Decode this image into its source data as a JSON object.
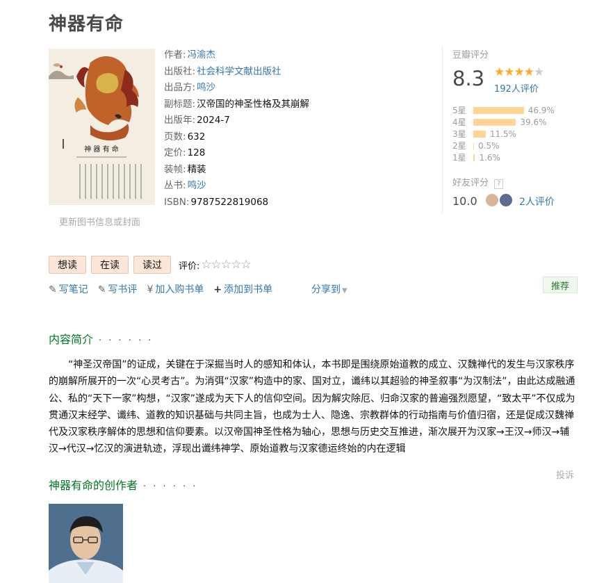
{
  "book": {
    "title": "神器有命",
    "update_cover": "更新图书信息或封面",
    "info": [
      {
        "label": "作者:",
        "value": "冯渝杰",
        "link": true
      },
      {
        "label": "出版社:",
        "value": "社会科学文献出版社",
        "link": true
      },
      {
        "label": "出品方:",
        "value": "鸣沙",
        "link": true
      },
      {
        "label": "副标题:",
        "value": "汉帝国的神圣性格及其崩解",
        "link": false
      },
      {
        "label": "出版年:",
        "value": "2024-7",
        "link": false
      },
      {
        "label": "页数:",
        "value": "632",
        "link": false
      },
      {
        "label": "定价:",
        "value": "128",
        "link": false
      },
      {
        "label": "装帧:",
        "value": "精装",
        "link": false
      },
      {
        "label": "丛书:",
        "value": "鸣沙",
        "link": true
      },
      {
        "label": "ISBN:",
        "value": "9787522819068",
        "link": false
      }
    ]
  },
  "rating": {
    "header": "豆瓣评分",
    "score": "8.3",
    "stars": "★★★★☆",
    "people": "192人评价",
    "bars": [
      {
        "label": "5星",
        "percent": "46.9%",
        "value": 46.9
      },
      {
        "label": "4星",
        "percent": "39.6%",
        "value": 39.6
      },
      {
        "label": "3星",
        "percent": "11.5%",
        "value": 11.5
      },
      {
        "label": "2星",
        "percent": "0.5%",
        "value": 0.5
      },
      {
        "label": "1星",
        "percent": "1.6%",
        "value": 1.6
      }
    ],
    "friend_header": "好友评分",
    "friend_help": "?",
    "friend_score": "10.0",
    "friend_count": "2人评价"
  },
  "actions": {
    "want": "想读",
    "reading": "在读",
    "read": "读过",
    "rate_label": "评价:",
    "empty_stars": "☆☆☆☆☆",
    "write_note": "写笔记",
    "write_review": "写书评",
    "add_cart": "加入购书单",
    "add_list": "添加到书单",
    "share": "分享到",
    "recommend": "推荐"
  },
  "intro": {
    "heading": "内容简介",
    "dots": "· · · · · ·",
    "text": "“神圣汉帝国”的证成，关键在于深掘当时人的感知和体认，本书即是围绕原始道教的成立、汉魏禅代的发生与汉家秩序的崩解所展开的一次“心灵考古”。为消弭“汉家”构造中的家、国对立，谶纬以其超验的神圣叙事“为汉制法”，由此达成融通公、私的“天下一家”构想，“汉家”遂成为天下人的信仰空间。因为解灾除厄、归命汉家的普遍强烈愿望，“致太平”不仅成为贯通汉末经学、谶纬、道教的知识基础与共同主旨，也成为士人、隐逸、宗教群体的行动指南与价值归宿，还是促成汉魏禅代及汉家秩序解体的思想和信仰要素。以汉帝国神圣性格为轴心，思想与历史交互推进，渐次展开为汉家→王汉→师汉→辅汉→代汉→忆汉的演进轨迹，浮现出谶纬神学、原始道教与汉家德运终始的内在逻辑",
    "report": "投诉"
  },
  "author_section": {
    "heading": "神器有命的创作者",
    "dots": "· · · · · ·"
  },
  "colors": {
    "link": "#3377aa",
    "section": "#007722",
    "bar": "#ffd596",
    "star": "#ffac2d"
  }
}
